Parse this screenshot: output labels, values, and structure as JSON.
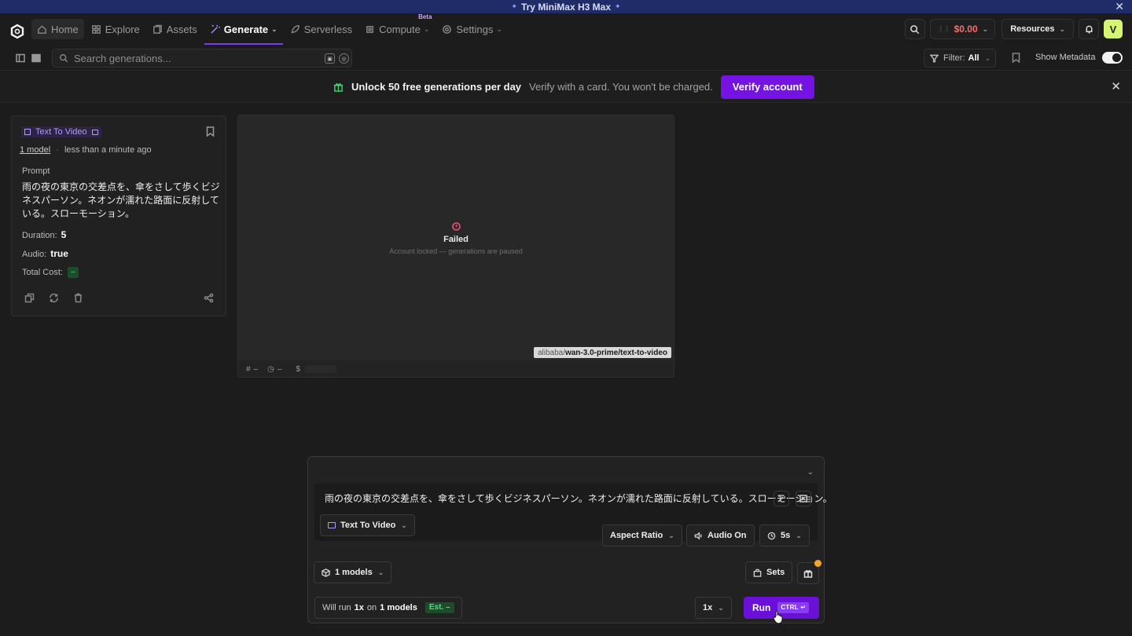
{
  "promo": {
    "text": "Try MiniMax H3 Max",
    "spark_left": "✦",
    "spark_right": "✦",
    "close": "✕"
  },
  "nav": {
    "items": [
      {
        "label": "Home",
        "icon": "home-icon"
      },
      {
        "label": "Explore",
        "icon": "grid-icon"
      },
      {
        "label": "Assets",
        "icon": "assets-icon"
      },
      {
        "label": "Generate",
        "icon": "wand-icon",
        "caret": "⌄"
      },
      {
        "label": "Serverless",
        "icon": "rocket-icon"
      },
      {
        "label": "Compute",
        "icon": "chip-icon",
        "caret": "⌄",
        "badge": "Beta"
      },
      {
        "label": "Settings",
        "icon": "gear-icon",
        "caret": "⌄"
      }
    ],
    "credits": "$0.00",
    "resources": "Resources",
    "avatar": "V"
  },
  "toolbar": {
    "search_placeholder": "Search generations...",
    "filter_label": "Filter:",
    "filter_value": "All",
    "show_metadata": "Show Metadata",
    "show_metadata_on": true
  },
  "banner": {
    "title": "Unlock 50 free generations per day",
    "subtitle": "Verify with a card. You won't be charged.",
    "button": "Verify account",
    "close": "✕"
  },
  "card": {
    "type_badge": "Text To Video",
    "model_count": "1 model",
    "separator": "·",
    "time": "less than a minute ago",
    "prompt_label": "Prompt",
    "prompt": "雨の夜の東京の交差点を、傘をさして歩くビジネスパーソン。ネオンが濡れた路面に反射している。スローモーション。",
    "duration_label": "Duration:",
    "duration": "5",
    "audio_label": "Audio:",
    "audio": "true",
    "cost_label": "Total Cost:",
    "cost": "–"
  },
  "preview": {
    "status": "Failed",
    "message": "Account locked — generations are paused",
    "model_org": "alibaba/",
    "model_name": "wan-3.0-prime/text-to-video",
    "seed_label": "#",
    "seed": "–",
    "time_value": "–",
    "cost_symbol": "$"
  },
  "composer": {
    "prompt": "雨の夜の東京の交差点を、傘をさして歩くビジネスパーソン。ネオンが濡れた路面に反射している。スローモーション。",
    "mode": "Text To Video",
    "aspect_ratio": "Aspect Ratio",
    "audio": "Audio On",
    "duration": "5s",
    "models": "1 models",
    "sets": "Sets",
    "will_run_prefix": "Will run",
    "will_run_count": "1x",
    "will_run_mid": "on",
    "will_run_models": "1 models",
    "est": "Est. –",
    "multiplier": "1x",
    "run": "Run",
    "shortcut": "CTRL ↵"
  }
}
